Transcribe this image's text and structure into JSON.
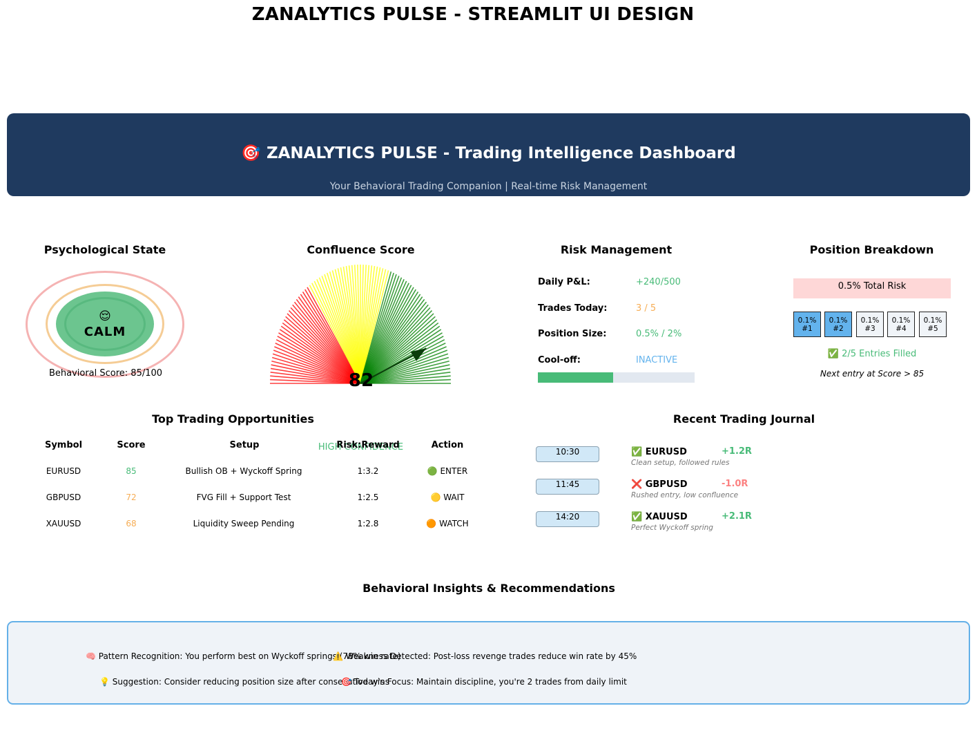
{
  "page_title": "ZANALYTICS PULSE - STREAMLIT UI DESIGN",
  "header": {
    "title": "🎯 ZANALYTICS PULSE - Trading Intelligence Dashboard",
    "subtitle": "Your Behavioral Trading Companion | Real-time Risk Management",
    "background_color": "#1f3a5f"
  },
  "psych": {
    "title": "Psychological State",
    "icon": "😌",
    "icon_name": "calm-face-icon",
    "state": "CALM",
    "score_text": "Behavioral Score: 85/100",
    "colors": {
      "inner": "#6cc58f",
      "mid_ring": "#f5cc95",
      "outer_ring": "#f5b3b3"
    }
  },
  "confluence": {
    "title": "Confluence Score",
    "score": 82,
    "score_text": "82",
    "max": 100,
    "label": "HIGH CONFIDENCE",
    "zones": [
      {
        "from": 0,
        "to": 30,
        "color": "#ff0000"
      },
      {
        "from": 30,
        "to": 60,
        "color": "#ffff00"
      },
      {
        "from": 60,
        "to": 100,
        "color": "#008000"
      }
    ]
  },
  "risk": {
    "title": "Risk Management",
    "rows": [
      {
        "label": "Daily P&L:",
        "value": "+240/500",
        "color": "#48bb78"
      },
      {
        "label": "Trades Today:",
        "value": "3 / 5",
        "color": "#f6ad55"
      },
      {
        "label": "Position Size:",
        "value": "0.5% / 2%",
        "color": "#48bb78"
      },
      {
        "label": "Cool-off:",
        "value": "INACTIVE",
        "color": "#63b3ed"
      }
    ],
    "pnl_progress": 0.48,
    "progress_color": "#48bb78",
    "track_color": "#e2e8f0"
  },
  "position": {
    "title": "Position Breakdown",
    "total_risk": "0.5% Total Risk",
    "entries": [
      {
        "pct": "0.1%",
        "id": "#1",
        "filled": true
      },
      {
        "pct": "0.1%",
        "id": "#2",
        "filled": true
      },
      {
        "pct": "0.1%",
        "id": "#3",
        "filled": false
      },
      {
        "pct": "0.1%",
        "id": "#4",
        "filled": false
      },
      {
        "pct": "0.1%",
        "id": "#5",
        "filled": false
      }
    ],
    "filled_text": "✅ 2/5 Entries Filled",
    "next_entry": "Next entry at Score > 85"
  },
  "opportunities": {
    "title": "Top Trading Opportunities",
    "columns": [
      "Symbol",
      "Score",
      "Setup",
      "Risk:Reward",
      "Action"
    ],
    "rows": [
      {
        "symbol": "EURUSD",
        "score": "85",
        "score_color": "#48bb78",
        "setup": "Bullish OB + Wyckoff Spring",
        "rr": "1:3.2",
        "action": "🟢 ENTER"
      },
      {
        "symbol": "GBPUSD",
        "score": "72",
        "score_color": "#f6ad55",
        "setup": "FVG Fill + Support Test",
        "rr": "1:2.5",
        "action": "🟡 WAIT"
      },
      {
        "symbol": "XAUUSD",
        "score": "68",
        "score_color": "#f6ad55",
        "setup": "Liquidity Sweep Pending",
        "rr": "1:2.8",
        "action": "🟠 WATCH"
      }
    ]
  },
  "journal": {
    "title": "Recent Trading Journal",
    "entries": [
      {
        "time": "10:30",
        "symbol": "✅ EURUSD",
        "r": "+1.2R",
        "r_color": "#48bb78",
        "note": "Clean setup, followed rules"
      },
      {
        "time": "11:45",
        "symbol": "❌ GBPUSD",
        "r": "-1.0R",
        "r_color": "#fc8181",
        "note": "Rushed entry, low confluence"
      },
      {
        "time": "14:20",
        "symbol": "✅ XAUUSD",
        "r": "+2.1R",
        "r_color": "#48bb78",
        "note": "Perfect Wyckoff spring"
      }
    ]
  },
  "insights": {
    "title": "Behavioral Insights & Recommendations",
    "items": [
      "🧠 Pattern Recognition: You perform best on Wyckoff springs (78% win rate)",
      "⚠️ Weakness Detected: Post-loss revenge trades reduce win rate by 45%",
      "💡 Suggestion: Consider reducing position size after consecutive wins",
      "🎯 Today's Focus: Maintain discipline, you're 2 trades from daily limit"
    ],
    "border_color": "#64b0e8"
  }
}
